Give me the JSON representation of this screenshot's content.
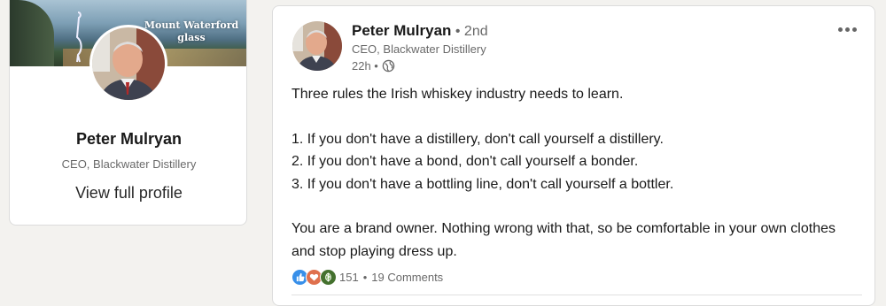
{
  "profile_card": {
    "cover_text": "Mount Waterford glass",
    "name": "Peter Mulryan",
    "headline": "CEO, Blackwater Distillery",
    "view_profile_label": "View full profile"
  },
  "post": {
    "author": {
      "name": "Peter Mulryan",
      "degree": " • 2nd",
      "headline": "CEO, Blackwater Distillery"
    },
    "time": "22h •",
    "visibility_icon": "globe-icon",
    "body": {
      "intro": "Three rules the Irish whiskey industry needs to learn.",
      "rules": [
        "1. If you don't have a distillery, don't call yourself a distillery.",
        "2. If you don't have a bond, don't call yourself a bonder.",
        "3. If you don't have a bottling line, don't call yourself a bottler."
      ],
      "closing": "You are a brand owner. Nothing wrong with that, so be comfortable in your own clothes and stop playing dress up."
    },
    "reactions": {
      "icons": [
        "like-icon",
        "love-icon",
        "insightful-icon"
      ],
      "count": "151",
      "separator": "•",
      "comments": "19 Comments"
    }
  },
  "colors": {
    "page_bg": "#f3f2ef",
    "like_blue": "#378fe9",
    "love_red": "#df704d",
    "insightful_green": "#44712e"
  }
}
